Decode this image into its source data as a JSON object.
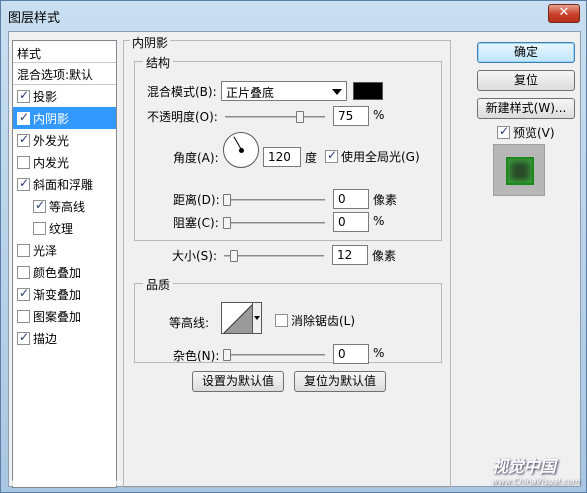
{
  "window": {
    "title": "图层样式",
    "close": "✕"
  },
  "styles": {
    "header": "样式",
    "blend_options": "混合选项:默认",
    "items": [
      {
        "label": "投影",
        "checked": true
      },
      {
        "label": "内阴影",
        "checked": true,
        "selected": true
      },
      {
        "label": "外发光",
        "checked": true
      },
      {
        "label": "内发光",
        "checked": false
      },
      {
        "label": "斜面和浮雕",
        "checked": true
      },
      {
        "label": "等高线",
        "checked": true,
        "indent": true
      },
      {
        "label": "纹理",
        "checked": false,
        "indent": true
      },
      {
        "label": "光泽",
        "checked": false
      },
      {
        "label": "颜色叠加",
        "checked": false
      },
      {
        "label": "渐变叠加",
        "checked": true
      },
      {
        "label": "图案叠加",
        "checked": false
      },
      {
        "label": "描边",
        "checked": true
      }
    ]
  },
  "panel": {
    "title": "内阴影",
    "structure": {
      "legend": "结构",
      "blend_mode_label": "混合模式(B):",
      "blend_mode_value": "正片叠底",
      "opacity_label": "不透明度(O):",
      "opacity_value": "75",
      "opacity_unit": "%",
      "opacity_level": 0.75,
      "angle_label": "角度(A):",
      "angle_value": "120",
      "angle_unit": "度",
      "global_light_label": "使用全局光(G)",
      "global_light_checked": true,
      "distance_label": "距离(D):",
      "distance_value": "0",
      "distance_unit": "像素",
      "choke_label": "阻塞(C):",
      "choke_value": "0",
      "choke_unit": "%",
      "size_label": "大小(S):",
      "size_value": "12",
      "size_unit": "像素"
    },
    "quality": {
      "legend": "品质",
      "contour_label": "等高线:",
      "antialias_label": "消除锯齿(L)",
      "antialias_checked": false,
      "noise_label": "杂色(N):",
      "noise_value": "0",
      "noise_unit": "%"
    },
    "set_default": "设置为默认值",
    "reset_default": "复位为默认值"
  },
  "actions": {
    "ok": "确定",
    "cancel": "复位",
    "new_style": "新建样式(W)...",
    "preview_label": "预览(V)",
    "preview_checked": true
  },
  "watermark": {
    "left": "www.ChinaVisual.com",
    "right": "视觉中国",
    "right_small": "www.ChinaVisual.com"
  },
  "colors": {
    "shadow_color": "#000000",
    "selection": "#3399ff"
  }
}
